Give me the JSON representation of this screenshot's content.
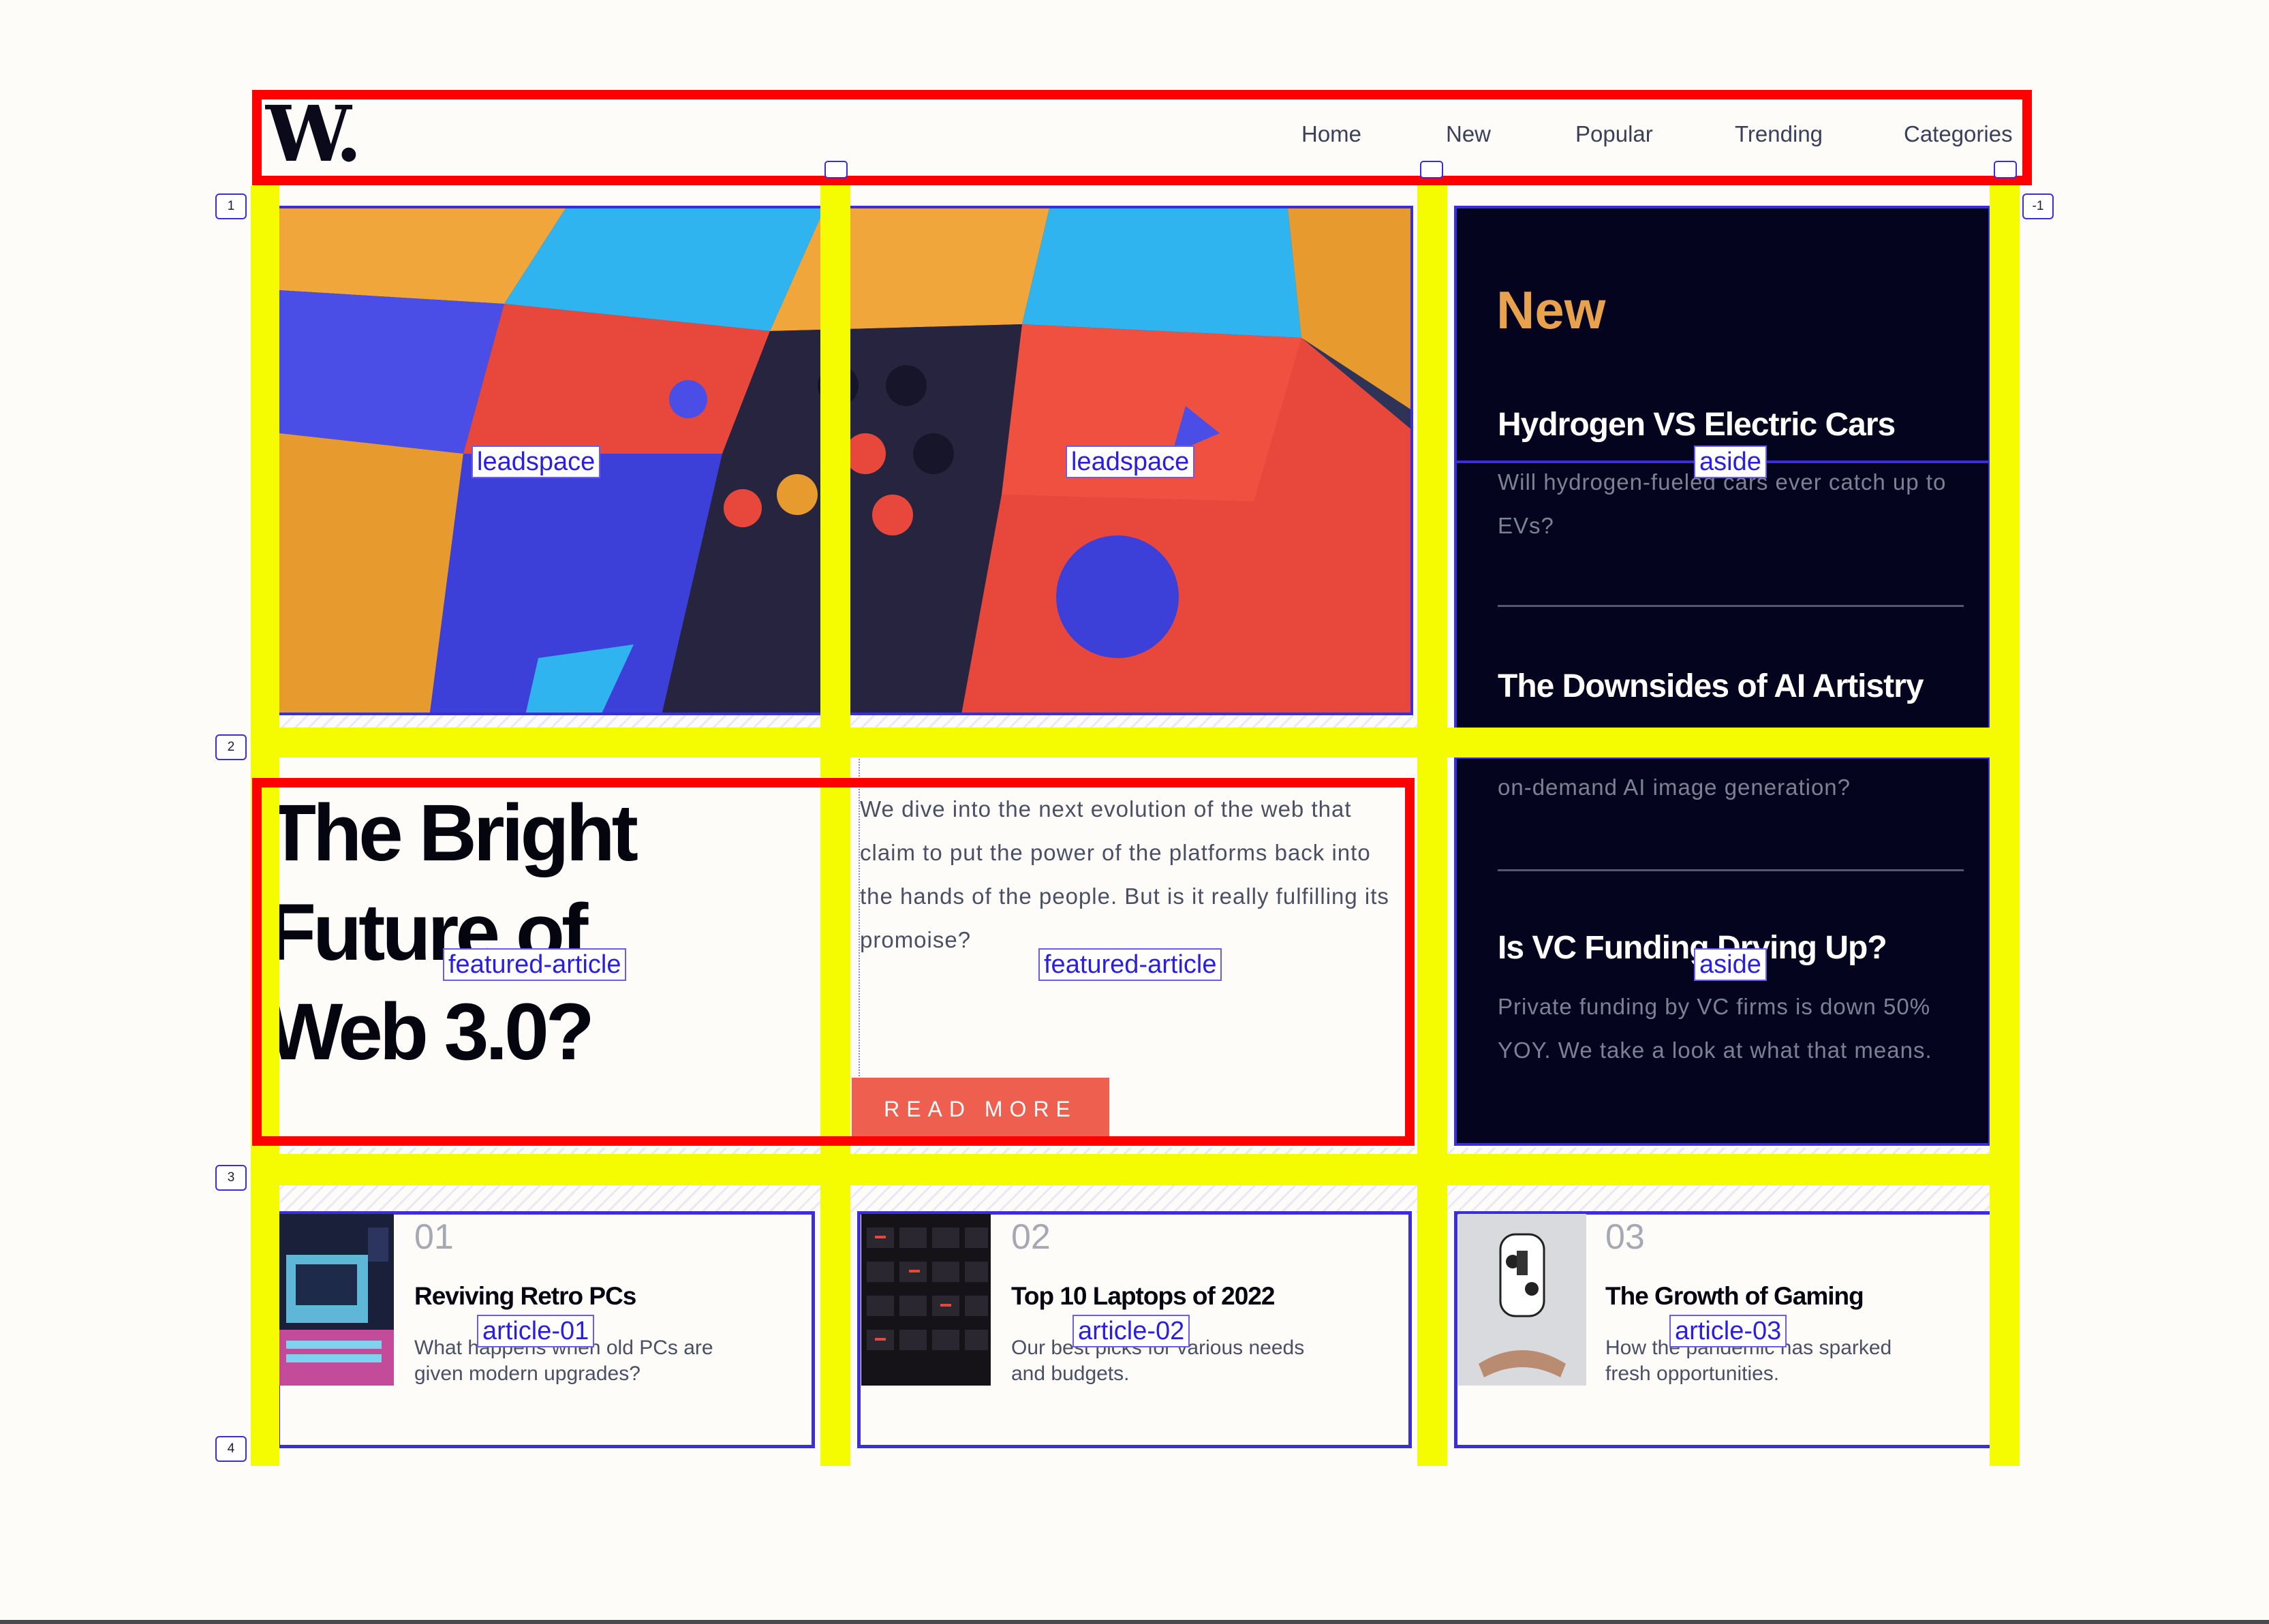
{
  "header": {
    "logo": "W.",
    "nav": [
      "Home",
      "New",
      "Popular",
      "Trending",
      "Categories"
    ]
  },
  "grid": {
    "row_lines": [
      "1",
      "2",
      "3",
      "4"
    ],
    "col_end_label": "-1"
  },
  "area_labels": {
    "leadspace": "leadspace",
    "aside": "aside",
    "featured": "featured-article",
    "article_01": "article-01",
    "article_02": "article-02",
    "article_03": "article-03"
  },
  "featured": {
    "headline": "The Bright Future of Web 3.0?",
    "lede": "We dive into the next evolution of the web that claim to put the power of the platforms back into the hands of the people. But is it really fulfilling its promoise?",
    "button": "READ MORE"
  },
  "aside": {
    "section_title": "New",
    "items": [
      {
        "title": "Hydrogen VS Electric Cars",
        "desc": "Will hydrogen-fueled cars ever catch up to EVs?"
      },
      {
        "title": "The Downsides of AI Artistry",
        "desc": "on-demand AI image generation?"
      },
      {
        "title": "Is VC Funding Drying Up?",
        "desc": "Private funding by VC firms is down 50% YOY. We take a look at what that means."
      }
    ]
  },
  "articles": [
    {
      "num": "01",
      "title": "Reviving Retro PCs",
      "desc": "What happens when old PCs are given modern upgrades?"
    },
    {
      "num": "02",
      "title": "Top 10 Laptops of 2022",
      "desc": "Our best picks for various needs and budgets."
    },
    {
      "num": "03",
      "title": "The Growth of Gaming",
      "desc": "How the pandemic has sparked fresh opportunities."
    }
  ],
  "colors": {
    "accent": "#ef5f50",
    "aside_bg": "#04041e",
    "aside_heading": "#e8a24c",
    "grid_outline": "#3a2ed8",
    "highlight_red": "#ff0000",
    "highlight_yellow": "#f5fb00"
  }
}
